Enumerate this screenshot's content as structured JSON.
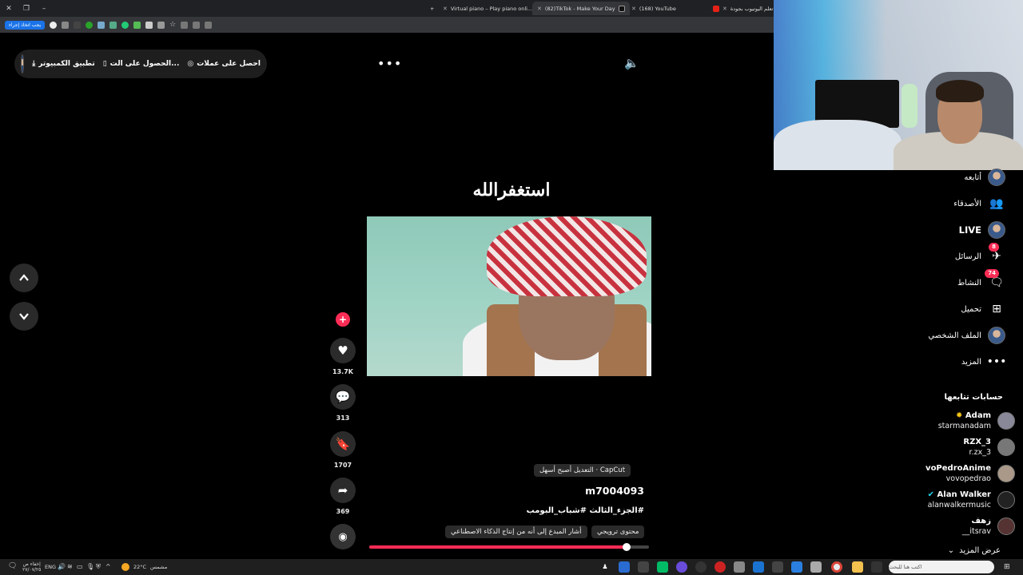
{
  "browser": {
    "tabs": [
      {
        "label": "Virtual piano – Play piano onli..."
      },
      {
        "label": "(82)TikTok - Make Your Day"
      },
      {
        "label": "(168) YouTube"
      },
      {
        "label": "تعلم اليوتيوب بجودة ..."
      }
    ],
    "extension_button": "يجب اتخاذ إجراء"
  },
  "topbar": {
    "desktop_app": "تطبيق الكمبيوتر",
    "get_app": "الحصول على الت...",
    "get_coins": "احصل على عملات"
  },
  "video": {
    "overlay_title": "استغفرالله",
    "likes": "13.7K",
    "comments": "313",
    "saves": "1707",
    "shares": "369",
    "capcut_chip": "CapCut · التعديل أصبح أسهل",
    "username": "m7004093",
    "description": "#الجزء_الثالث #شباب_البومب",
    "chip_ai": "أشار المبدع إلى أنه من إنتاج الذكاء الاصطناعي",
    "chip_promo": "محتوى ترويجي",
    "progress": 0.92
  },
  "sidebar": {
    "following": "أتابعه",
    "friends": "الأصدقاء",
    "live": "LIVE",
    "messages": "الرسائل",
    "messages_badge": "8",
    "activity": "النشاط",
    "activity_badge": "74",
    "upload": "تحميل",
    "profile": "الملف الشخصي",
    "more": "المزيد",
    "following_accounts_title": "حسابات تتابعها",
    "accounts": [
      {
        "name": "Adam",
        "handle": "starmanadam"
      },
      {
        "name": "RZX_3",
        "handle": "r.zx_3"
      },
      {
        "name": "voPedroAnime",
        "handle": "vovopedrao"
      },
      {
        "name": "Alan Walker",
        "handle": "alanwalkermusic"
      },
      {
        "name": "زهف",
        "handle": "__itsrav"
      }
    ],
    "see_more": "عرض المزيد"
  },
  "taskbar": {
    "weather": "22°C",
    "weather_label": "مشمس",
    "lang": "ENG",
    "time": "إخفاء ص",
    "date": "٢٧/٠٧/٢٥",
    "search_placeholder": "اكتب هنا للبحث"
  },
  "colors": {
    "accent": "#fe2c55",
    "background": "#000000"
  }
}
